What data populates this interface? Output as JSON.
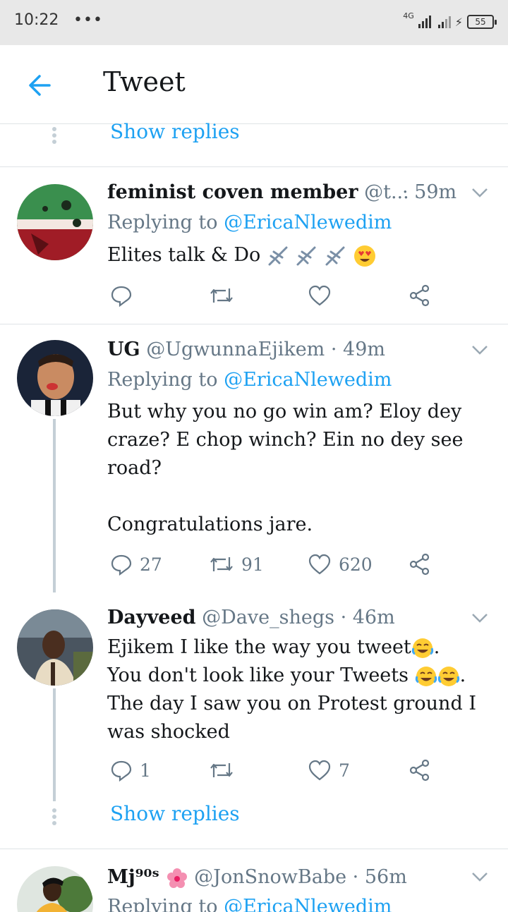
{
  "status_bar": {
    "time": "10:22",
    "dots": "•••",
    "network": "4G",
    "battery": "55"
  },
  "header": {
    "title": "Tweet"
  },
  "show_replies_label": "Show replies",
  "tweets": [
    {
      "name": "feminist coven member",
      "handle": "@t...",
      "time": "· 59m",
      "replying_prefix": "Replying to",
      "replying_handle": "@EricaNlewedim",
      "text": "Elites talk & Do",
      "emojis": [
        "airplane-emoji",
        "airplane-emoji",
        "airplane-emoji",
        "heart-eyes-emoji"
      ],
      "reply_count": "",
      "retweet_count": "",
      "like_count": ""
    },
    {
      "name": "UG",
      "handle": "@UgwunnaEjikem",
      "time": "· 49m",
      "replying_prefix": "Replying to",
      "replying_handle": "@EricaNlewedim",
      "text_lines": [
        "But why you no go win am? Eloy dey",
        "craze? E chop winch? Ein no dey see",
        "road?",
        "",
        "Congratulations jare."
      ],
      "reply_count": "27",
      "retweet_count": "91",
      "like_count": "620"
    },
    {
      "name": "Dayveed",
      "handle": "@Dave_shegs",
      "time": "· 46m",
      "text_lines": [
        "Ejikem I like the way you tweet",
        "You don't look like your Tweets",
        "The day I saw you on Protest ground I",
        "was shocked"
      ],
      "line_suffix_1": ".",
      "line_suffix_2": ".",
      "reply_count": "1",
      "retweet_count": "",
      "like_count": "7"
    },
    {
      "name": "Mj⁹⁰ˢ",
      "handle": "@JonSnowBabe",
      "time": "· 56m",
      "replying_prefix": "Replying to",
      "replying_handle": "@EricaNlewedim"
    }
  ],
  "colors": {
    "accent": "#1da1f2",
    "muted": "#657786",
    "text": "#14171a",
    "divider": "#dfe3e6"
  }
}
